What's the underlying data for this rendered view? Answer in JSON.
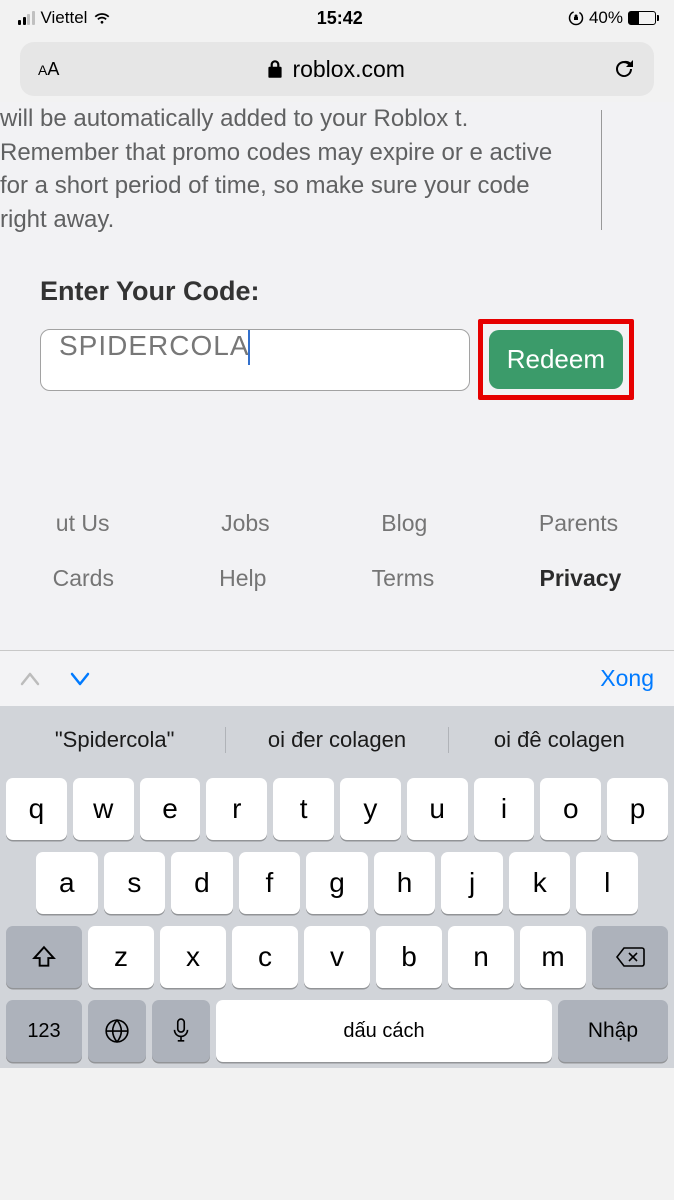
{
  "status": {
    "carrier": "Viettel",
    "time": "15:42",
    "battery_pct": "40%"
  },
  "urlbar": {
    "domain": "roblox.com"
  },
  "page": {
    "instruction": "will be automatically added to your Roblox t. Remember that promo codes may expire or e active for a short period of time, so make sure your code right away.",
    "code_label": "Enter Your Code:",
    "code_value": "SPIDERCOLA",
    "redeem_label": "Redeem"
  },
  "footer": {
    "row1": [
      "ut Us",
      "Jobs",
      "Blog",
      "Parents"
    ],
    "row2": [
      "Cards",
      "Help",
      "Terms",
      "Privacy"
    ]
  },
  "kb_accessory": {
    "done": "Xong"
  },
  "keyboard": {
    "suggestions": [
      "\"Spidercola\"",
      "oi đer colagen",
      "oi đê colagen"
    ],
    "row1": [
      "q",
      "w",
      "e",
      "r",
      "t",
      "y",
      "u",
      "i",
      "o",
      "p"
    ],
    "row2": [
      "a",
      "s",
      "d",
      "f",
      "g",
      "h",
      "j",
      "k",
      "l"
    ],
    "row3": [
      "z",
      "x",
      "c",
      "v",
      "b",
      "n",
      "m"
    ],
    "key_123": "123",
    "key_space": "dấu cách",
    "key_return": "Nhập"
  }
}
